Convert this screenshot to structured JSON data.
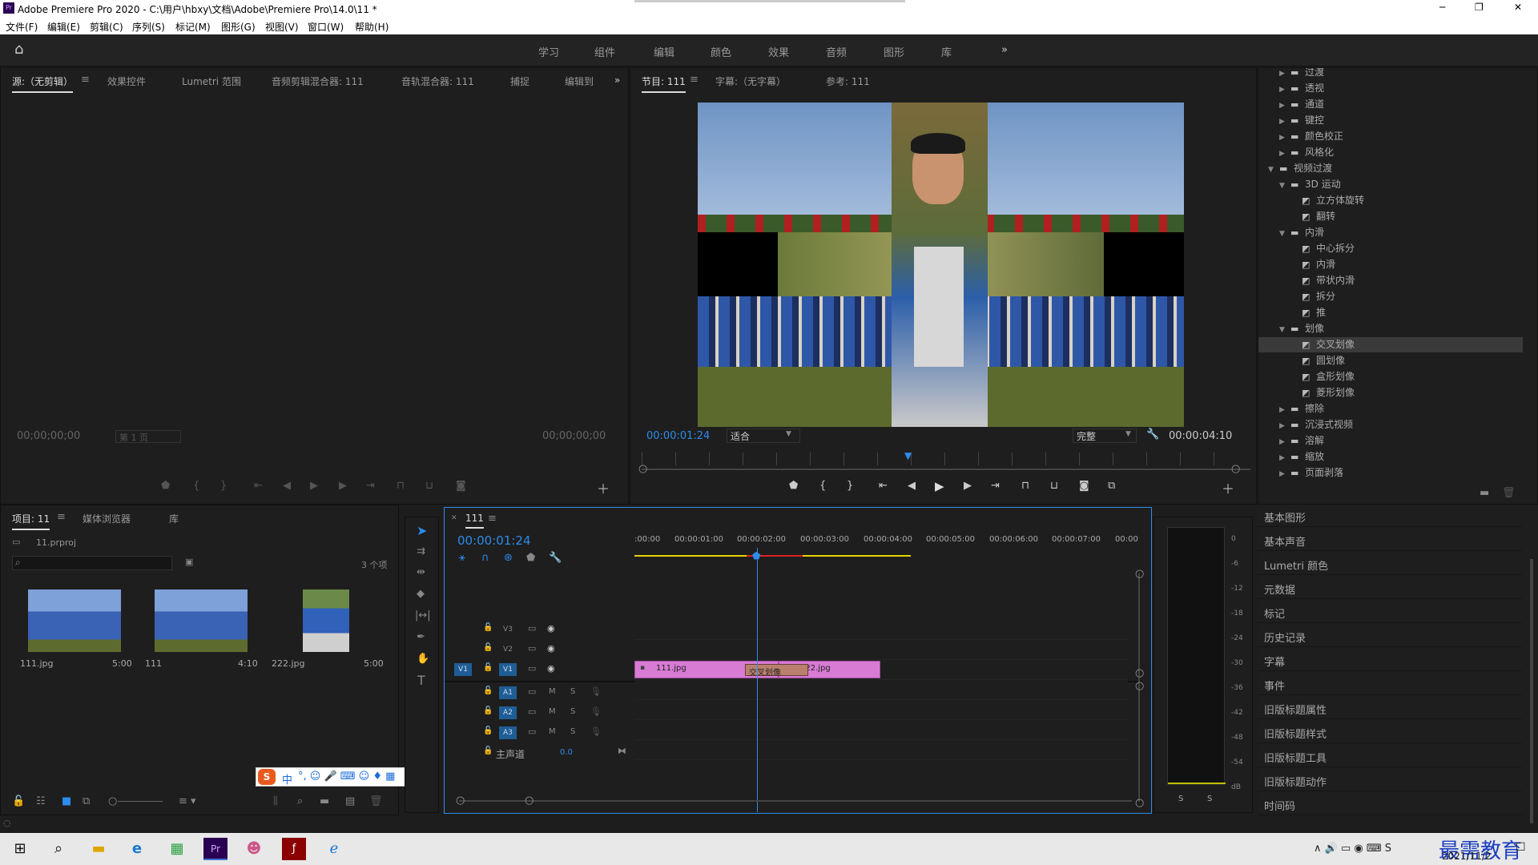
{
  "titlebar": {
    "title": "Adobe Premiere Pro 2020 - C:\\用户\\hbxy\\文档\\Adobe\\Premiere Pro\\14.0\\11 *",
    "min": "─",
    "max": "❐",
    "close": "✕"
  },
  "menu": [
    "文件(F)",
    "编辑(E)",
    "剪辑(C)",
    "序列(S)",
    "标记(M)",
    "图形(G)",
    "视图(V)",
    "窗口(W)",
    "帮助(H)"
  ],
  "workspaces": [
    "学习",
    "组件",
    "编辑",
    "颜色",
    "效果",
    "音频",
    "图形",
    "库"
  ],
  "ws_more": "»",
  "source_tabs": [
    "源:（无剪辑）",
    "效果控件",
    "Lumetri 范围",
    "音频剪辑混合器: 111",
    "音轨混合器: 111",
    "捕捉",
    "编辑到"
  ],
  "source_more": "»",
  "source": {
    "tc_left": "00;00;00;00",
    "tc_right": "00;00;00;00",
    "page": "第 1 页"
  },
  "program_tabs": [
    "节目: 111",
    "字幕:（无字幕）",
    "参考: 111"
  ],
  "program": {
    "tc_left": "00:00:01:24",
    "fit": "适合",
    "quality": "完整",
    "tc_right": "00:00:04:10"
  },
  "effects_tree": [
    {
      "label": "过渡",
      "level": 1,
      "type": "folder",
      "open": false
    },
    {
      "label": "透视",
      "level": 1,
      "type": "folder",
      "open": false
    },
    {
      "label": "通道",
      "level": 1,
      "type": "folder",
      "open": false
    },
    {
      "label": "键控",
      "level": 1,
      "type": "folder",
      "open": false
    },
    {
      "label": "颜色校正",
      "level": 1,
      "type": "folder",
      "open": false
    },
    {
      "label": "风格化",
      "level": 1,
      "type": "folder",
      "open": false
    },
    {
      "label": "视频过渡",
      "level": 0,
      "type": "folder",
      "open": true
    },
    {
      "label": "3D 运动",
      "level": 1,
      "type": "folder",
      "open": true
    },
    {
      "label": "立方体旋转",
      "level": 2,
      "type": "effect"
    },
    {
      "label": "翻转",
      "level": 2,
      "type": "effect"
    },
    {
      "label": "内滑",
      "level": 1,
      "type": "folder",
      "open": true
    },
    {
      "label": "中心拆分",
      "level": 2,
      "type": "effect"
    },
    {
      "label": "内滑",
      "level": 2,
      "type": "effect"
    },
    {
      "label": "带状内滑",
      "level": 2,
      "type": "effect"
    },
    {
      "label": "拆分",
      "level": 2,
      "type": "effect"
    },
    {
      "label": "推",
      "level": 2,
      "type": "effect"
    },
    {
      "label": "划像",
      "level": 1,
      "type": "folder",
      "open": true
    },
    {
      "label": "交叉划像",
      "level": 2,
      "type": "effect",
      "selected": true
    },
    {
      "label": "圆划像",
      "level": 2,
      "type": "effect"
    },
    {
      "label": "盒形划像",
      "level": 2,
      "type": "effect"
    },
    {
      "label": "菱形划像",
      "level": 2,
      "type": "effect"
    },
    {
      "label": "擦除",
      "level": 1,
      "type": "folder",
      "open": false
    },
    {
      "label": "沉浸式视频",
      "level": 1,
      "type": "folder",
      "open": false
    },
    {
      "label": "溶解",
      "level": 1,
      "type": "folder",
      "open": false
    },
    {
      "label": "缩放",
      "level": 1,
      "type": "folder",
      "open": false
    },
    {
      "label": "页面剥落",
      "level": 1,
      "type": "folder",
      "open": false
    }
  ],
  "right_panels": [
    "基本图形",
    "基本声音",
    "Lumetri 颜色",
    "元数据",
    "标记",
    "历史记录",
    "字幕",
    "事件",
    "旧版标题属性",
    "旧版标题样式",
    "旧版标题工具",
    "旧版标题动作",
    "时间码"
  ],
  "project": {
    "tabs": [
      "项目: 11",
      "媒体浏览器",
      "库"
    ],
    "file": "11.prproj",
    "count": "3 个项",
    "search_placeholder": "",
    "items": [
      {
        "name": "111.jpg",
        "dur": "5:00"
      },
      {
        "name": "111",
        "dur": "4:10"
      },
      {
        "name": "222.jpg",
        "dur": "5:00"
      }
    ]
  },
  "timeline": {
    "tab": "111",
    "tc": "00:00:01:24",
    "ruler": [
      ":00:00",
      "00:00:01:00",
      "00:00:02:00",
      "00:00:03:00",
      "00:00:04:00",
      "00:00:05:00",
      "00:00:06:00",
      "00:00:07:00",
      "00:00"
    ],
    "video_tracks": [
      "V3",
      "V2",
      "V1"
    ],
    "audio_tracks": [
      "A1",
      "A2",
      "A3"
    ],
    "src_v": "V1",
    "master": "主声道",
    "master_val": "0.0",
    "clips": [
      {
        "name": "111.jpg"
      },
      {
        "name": "222.jpg"
      }
    ],
    "transition": "交叉划像",
    "m": "M",
    "s": "S"
  },
  "meter": {
    "scale": [
      "0",
      "-6",
      "-12",
      "-18",
      "-24",
      "-30",
      "-36",
      "-42",
      "-48",
      "-54",
      "dB"
    ],
    "solo": [
      "S",
      "S"
    ]
  },
  "ime": {
    "label": "中"
  },
  "taskbar": {
    "date": "2021/11/2",
    "watermark": "最需教育"
  }
}
